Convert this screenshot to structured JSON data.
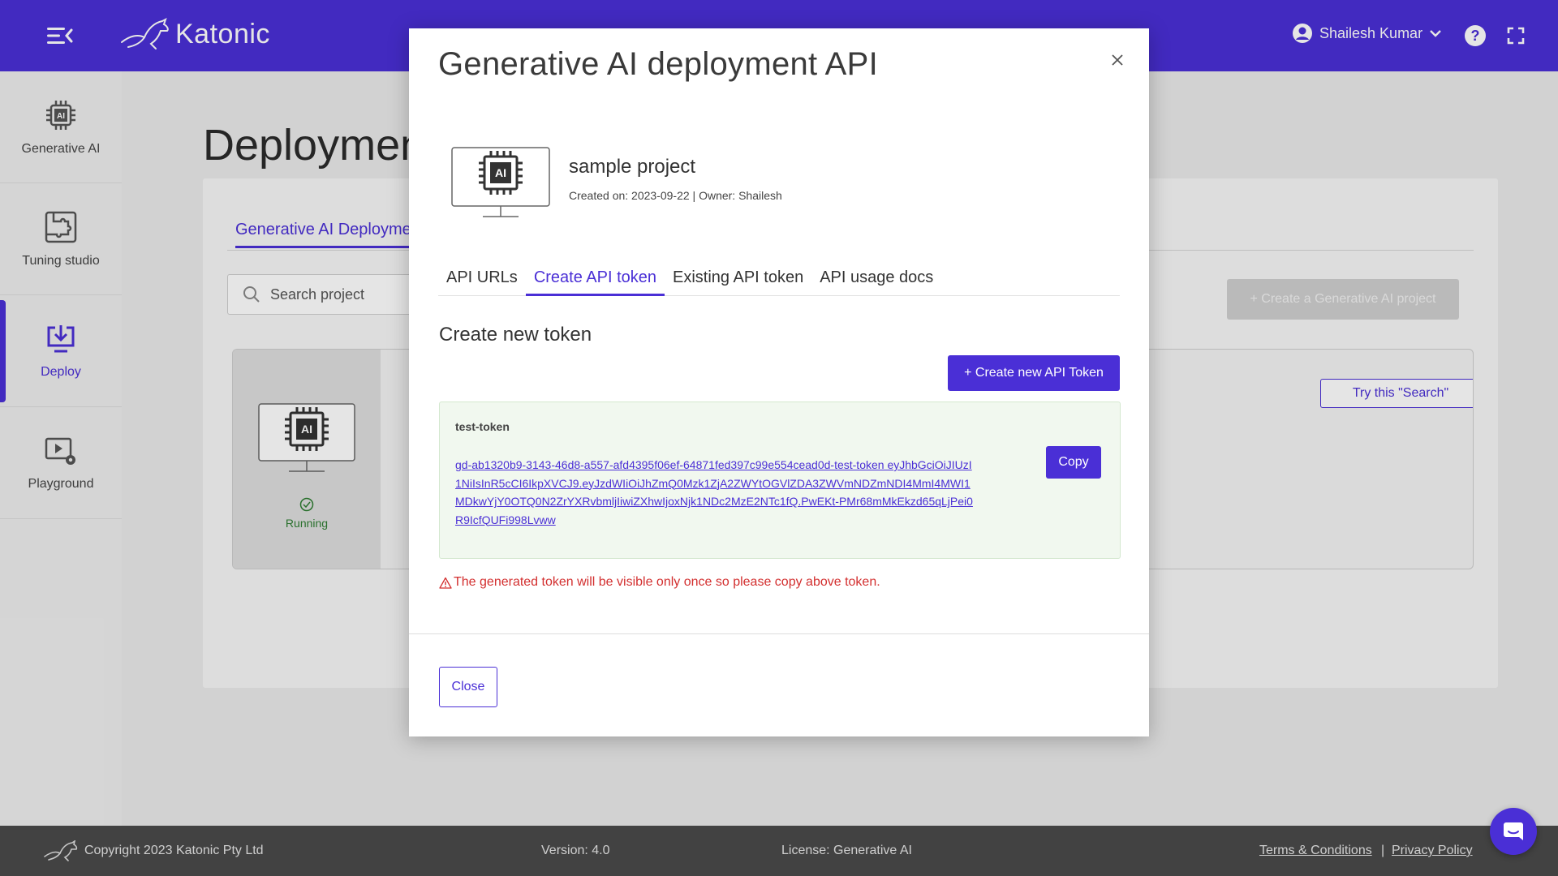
{
  "header": {
    "logo_text": "Katonic",
    "user_name": "Shailesh Kumar"
  },
  "sidebar": {
    "items": [
      {
        "label": "Generative AI"
      },
      {
        "label": "Tuning studio"
      },
      {
        "label": "Deploy"
      },
      {
        "label": "Playground"
      }
    ]
  },
  "main": {
    "page_title": "Deploymen",
    "tab_label": "Generative AI Deploymen",
    "search_placeholder": "Search project",
    "create_project_label": "+ Create a Generative AI project",
    "card_status": "Running",
    "try_search_label": "Try this \"Search\""
  },
  "modal": {
    "title": "Generative AI deployment API",
    "project_name": "sample project",
    "project_meta": "Created on: 2023-09-22 | Owner: Shailesh",
    "tabs": [
      {
        "label": "API URLs",
        "active": false
      },
      {
        "label": "Create API token",
        "active": true
      },
      {
        "label": "Existing API token",
        "active": false
      },
      {
        "label": "API usage docs",
        "active": false
      }
    ],
    "section_title": "Create new token",
    "create_button": "+ Create new API Token",
    "token_name": "test-token",
    "token_value": "gd-ab1320b9-3143-46d8-a557-afd4395f06ef-64871fed397c99e554cead0d-test-token eyJhbGciOiJIUzI1NiIsInR5cCI6IkpXVCJ9.eyJzdWIiOiJhZmQ0Mzk1ZjA2ZWYtOGVlZDA3ZWVmNDZmNDI4MmI4MWI1MDkwYjY0OTQ0N2ZrYXRvbmljIiwiZXhwIjoxNjk1NDc2MzE2NTc1fQ.PwEKt-PMr68mMkEkzd65qLjPei0R9IcfQUFi998Lvww",
    "copy_button": "Copy",
    "warning": "The generated token will be visible only once so please copy above token.",
    "close_button": "Close"
  },
  "footer": {
    "copyright": "Copyright 2023 Katonic Pty Ltd",
    "version": "Version: 4.0",
    "license": "License: Generative AI",
    "terms": "Terms & Conditions",
    "separator": "|",
    "privacy": "Privacy Policy"
  },
  "colors": {
    "brand": "#4a2fd6",
    "success": "#2e7d32",
    "error": "#d32f2f"
  }
}
